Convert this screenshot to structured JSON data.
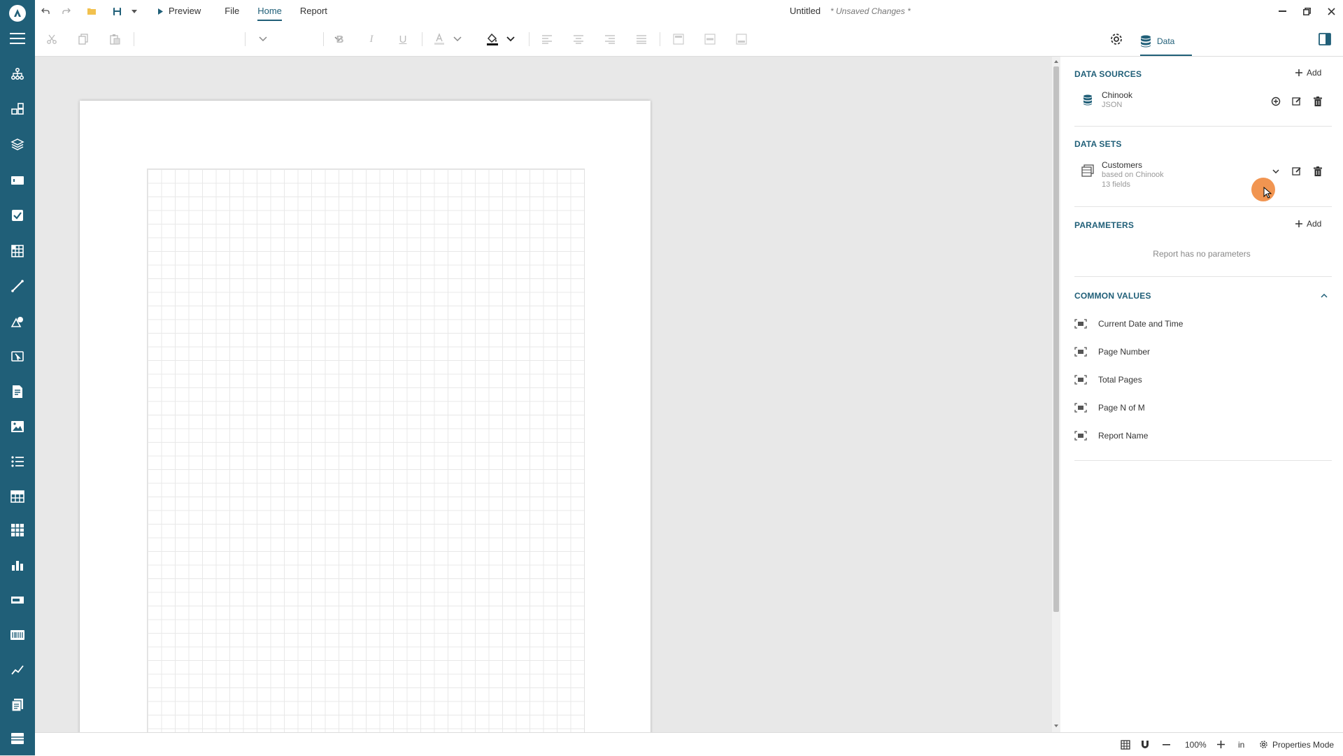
{
  "app": {
    "menu": {
      "preview": "Preview",
      "file": "File",
      "home": "Home",
      "report": "Report"
    },
    "doc_title": "Untitled",
    "unsaved": "* Unsaved Changes *"
  },
  "toolbar": {
    "data_tab_label": "Data"
  },
  "panel": {
    "data_sources": {
      "title": "DATA SOURCES",
      "add_label": "Add",
      "items": [
        {
          "name": "Chinook",
          "type": "JSON"
        }
      ]
    },
    "data_sets": {
      "title": "DATA SETS",
      "items": [
        {
          "name": "Customers",
          "based_on": "based on Chinook",
          "fields": "13 fields"
        }
      ]
    },
    "parameters": {
      "title": "PARAMETERS",
      "add_label": "Add",
      "empty_text": "Report has no parameters"
    },
    "common_values": {
      "title": "COMMON VALUES",
      "items": [
        "Current Date and Time",
        "Page Number",
        "Total Pages",
        "Page N of M",
        "Report Name"
      ]
    }
  },
  "status": {
    "zoom": "100%",
    "units": "in",
    "properties_mode": "Properties Mode"
  },
  "colors": {
    "rail": "#205f78",
    "accent": "#205f78",
    "cursor": "#f0893e"
  }
}
